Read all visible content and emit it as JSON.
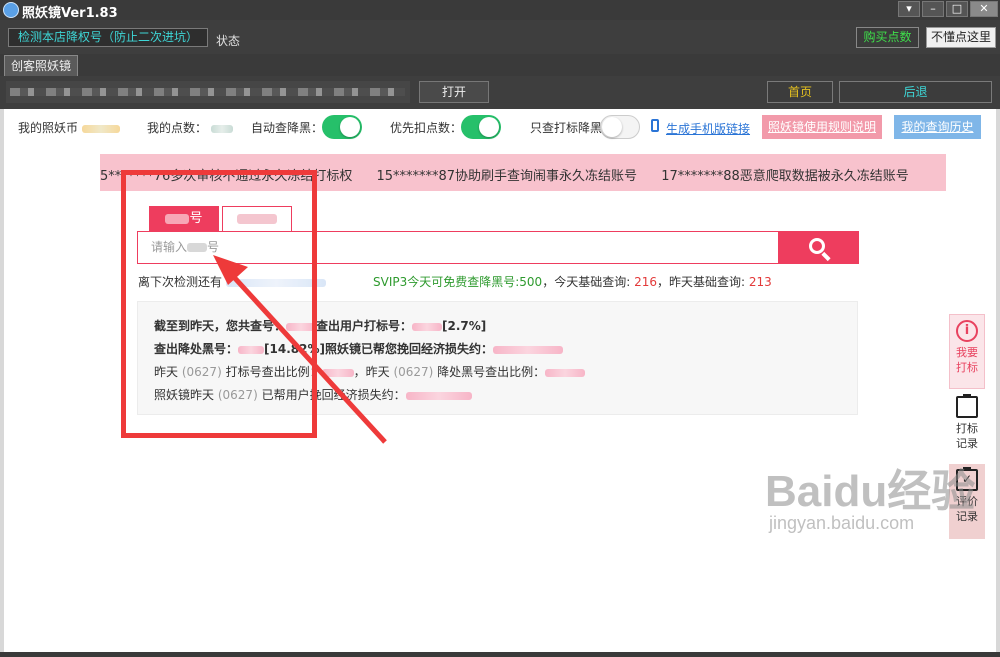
{
  "window": {
    "title": "照妖镜Ver1.83",
    "controls": [
      "▾",
      "–",
      "□",
      "✕"
    ]
  },
  "toolbar": {
    "detect_label": "检测本店降权号（防止二次进坑）",
    "status_label": "状态",
    "buy_label": "购买点数",
    "help_label": "不懂点这里"
  },
  "tabs": [
    {
      "label": "创客照妖镜"
    }
  ],
  "urlbar": {
    "open_label": "打开",
    "home_label": "首页",
    "back_label": "后退"
  },
  "options": {
    "coins_label": "我的照妖币",
    "points_label": "我的点数：",
    "auto_check_label": "自动查降黑：",
    "auto_check_on": true,
    "priority_label": "优先扣点数：",
    "priority_on": true,
    "only_label": "只查打标降黑",
    "only_on": false,
    "mobile_link": "生成手机版链接",
    "rules_label": "照妖镜使用规则说明",
    "history_label": "我的查询历史",
    "accent_green": "#26c06a",
    "accent_pink": "#ee3d5e"
  },
  "ticker": {
    "items": [
      "5*******76多次审核不通过永久冻结打标权",
      "15*******87协助刷手查询闹事永久冻结账号",
      "17*******88恶意爬取数据被永久冻结账号"
    ]
  },
  "search": {
    "tab1_label": "号",
    "placeholder_prefix": "请输入",
    "placeholder_suffix": "号",
    "next_check_prefix": "离下次检测还有",
    "svip_prefix": "SVIP3今天可免费查降黑号:",
    "svip_value": "500",
    "today_label": "，今天基础查询:",
    "today_value": "216",
    "yesterday_label": "，昨天基础查询:",
    "yesterday_value": "213"
  },
  "stats": {
    "line1_a": "截至到昨天，您共查号：",
    "line1_b": "查出用户打标号：",
    "line1_c": "[2.7%]",
    "line2_a": "查出降处黑号：",
    "line2_b": "[14.82%]",
    "line2_c": "照妖镜已帮您挽回经济损失约：",
    "line3_a": "昨天",
    "line3_date": "(0627)",
    "line3_b": "打标号查出比例：",
    "line3_c": "，昨天",
    "line3_date2": "(0627)",
    "line3_d": "降处黑号查出比例：",
    "line4_a": "照妖镜昨天",
    "line4_date": "(0627)",
    "line4_b": "已帮用户挽回经济损失约："
  },
  "side": {
    "item1": [
      "我要",
      "打标"
    ],
    "item2": [
      "打标",
      "记录"
    ],
    "item3": [
      "评价",
      "记录"
    ]
  },
  "watermark": {
    "main": "Baidu经验",
    "sub": "jingyan.baidu.com"
  },
  "icons": {
    "info": "i",
    "clipboard": "✓"
  }
}
